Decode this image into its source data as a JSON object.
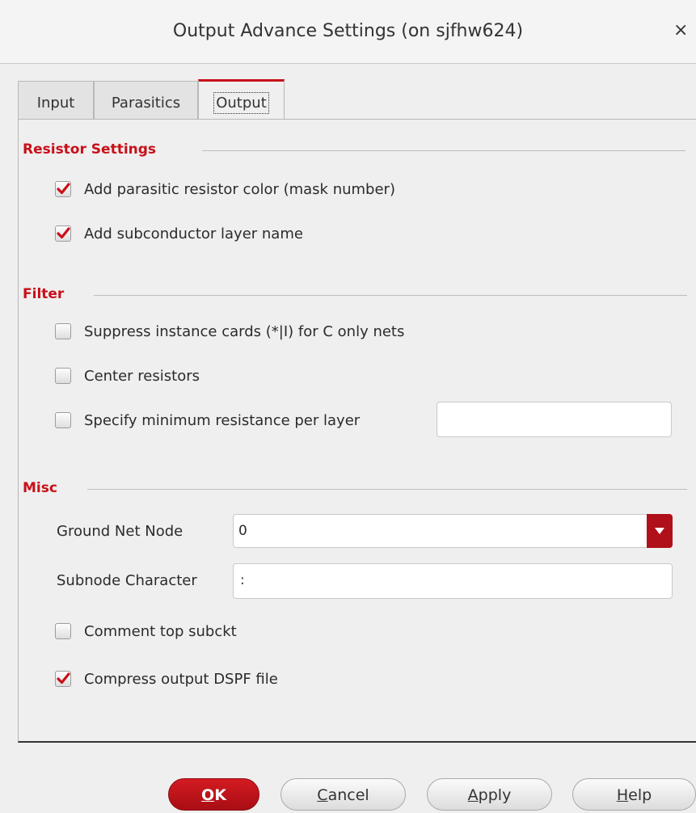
{
  "window": {
    "title": "Output Advance Settings (on sjfhw624)",
    "close_symbol": "×"
  },
  "tabs": [
    {
      "label": "Input"
    },
    {
      "label": "Parasitics"
    },
    {
      "label": "Output"
    }
  ],
  "resistor_settings": {
    "heading": "Resistor Settings",
    "options": [
      {
        "label": "Add parasitic resistor color (mask number)",
        "checked": true
      },
      {
        "label": "Add subconductor layer name",
        "checked": true
      }
    ]
  },
  "filter": {
    "heading": "Filter",
    "options": [
      {
        "label": "Suppress instance cards (*|I) for C only nets",
        "checked": false
      },
      {
        "label": "Center resistors",
        "checked": false
      },
      {
        "label": "Specify minimum resistance per layer",
        "checked": false
      }
    ],
    "min_resistance_value": ""
  },
  "misc": {
    "heading": "Misc",
    "ground_net_label": "Ground Net Node",
    "ground_net_value": "0",
    "subnode_label": "Subnode Character",
    "subnode_value": ":",
    "options": [
      {
        "label": "Comment top subckt",
        "checked": false
      },
      {
        "label": "Compress output DSPF file",
        "checked": true
      }
    ]
  },
  "buttons": {
    "ok": {
      "mnemonic": "O",
      "rest": "K"
    },
    "cancel": {
      "mnemonic": "C",
      "rest": "ancel"
    },
    "apply": {
      "mnemonic": "A",
      "rest": "pply"
    },
    "help": {
      "mnemonic": "H",
      "rest": "elp"
    }
  },
  "colors": {
    "accent": "#c8101a",
    "check": "#c8101a"
  }
}
